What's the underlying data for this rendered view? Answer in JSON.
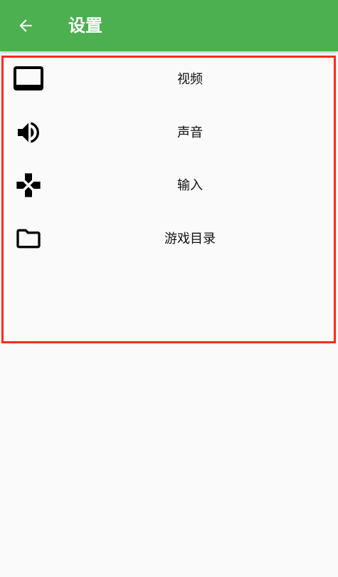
{
  "app_bar": {
    "title": "设置",
    "back_icon": "arrow-left-icon",
    "color": "#4caf50"
  },
  "settings": {
    "items": [
      {
        "label": "视频",
        "icon": "monitor-icon"
      },
      {
        "label": "声音",
        "icon": "volume-icon"
      },
      {
        "label": "输入",
        "icon": "gamepad-icon"
      },
      {
        "label": "游戏目录",
        "icon": "folder-icon"
      }
    ],
    "highlight_color": "#ff2a1a"
  }
}
